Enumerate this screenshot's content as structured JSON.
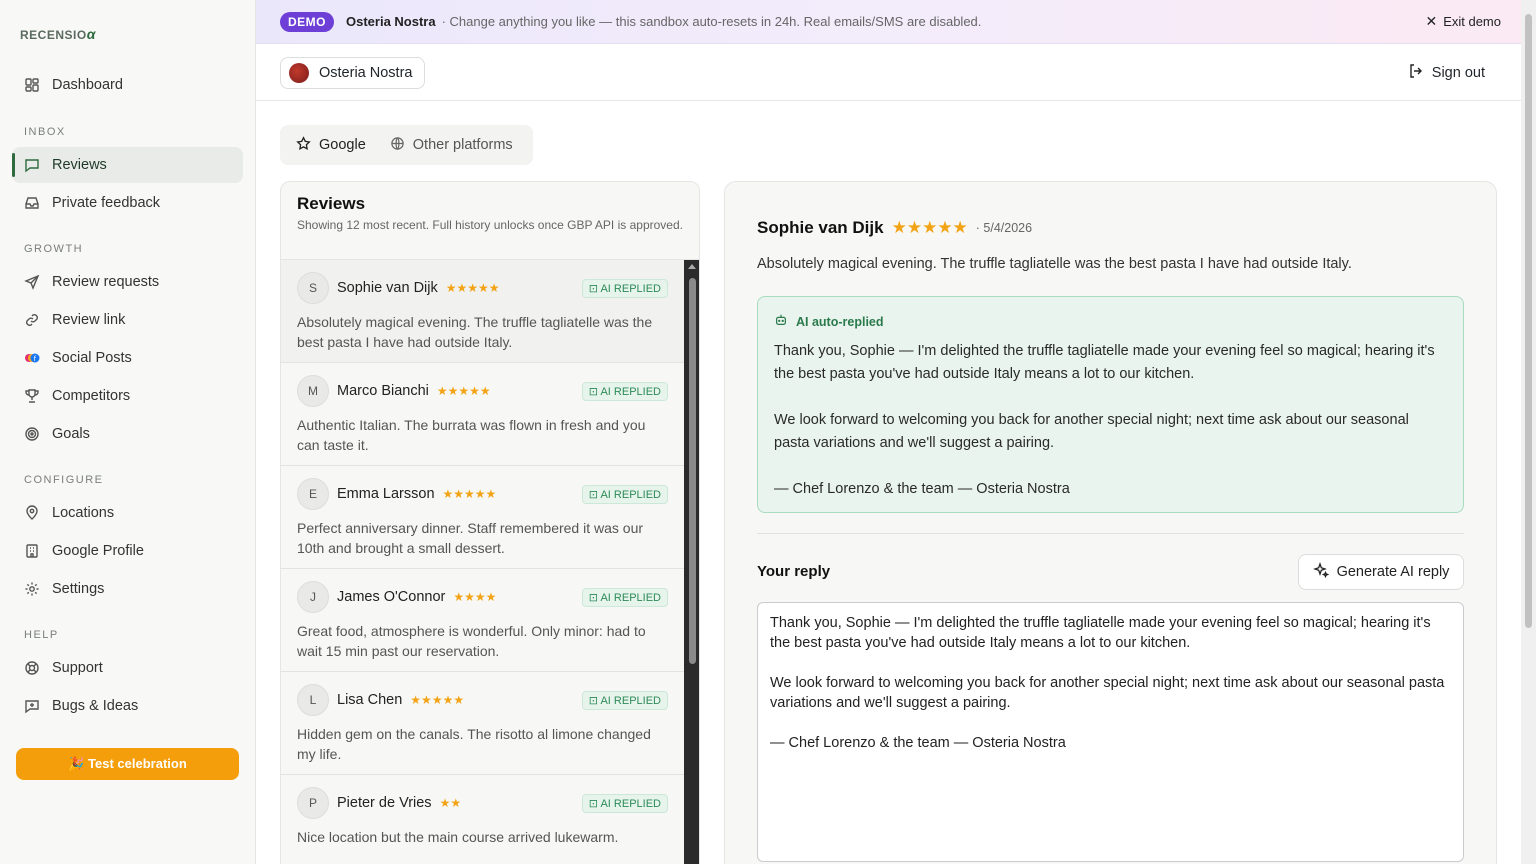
{
  "brand": {
    "logo_text": "RECENSIO",
    "logo_mark": "α"
  },
  "sidebar": {
    "dashboard": "Dashboard",
    "sections": {
      "inbox": "INBOX",
      "growth": "GROWTH",
      "configure": "CONFIGURE",
      "help": "HELP"
    },
    "items": {
      "reviews": "Reviews",
      "private_feedback": "Private feedback",
      "review_requests": "Review requests",
      "review_link": "Review link",
      "social_posts": "Social Posts",
      "competitors": "Competitors",
      "goals": "Goals",
      "locations": "Locations",
      "google_profile": "Google Profile",
      "settings": "Settings",
      "support": "Support",
      "bugs_ideas": "Bugs & Ideas"
    },
    "celebrate_button": "🎉 Test celebration"
  },
  "banner": {
    "pill": "DEMO",
    "business": "Osteria Nostra",
    "message": "· Change anything you like — this sandbox auto-resets in 24h. Real emails/SMS are disabled.",
    "exit": "Exit demo"
  },
  "topbar": {
    "location": "Osteria Nostra",
    "sign_out": "Sign out"
  },
  "tabs": {
    "google": "Google",
    "other": "Other platforms"
  },
  "list": {
    "title": "Reviews",
    "subtitle": "Showing 12 most recent. Full history unlocks once GBP API is approved.",
    "badge": "AI REPLIED",
    "reviews": [
      {
        "initial": "S",
        "name": "Sophie van Dijk",
        "stars": "★★★★★",
        "rating": 5,
        "text": "Absolutely magical evening. The truffle tagliatelle was the best pasta I have had outside Italy."
      },
      {
        "initial": "M",
        "name": "Marco Bianchi",
        "stars": "★★★★★",
        "rating": 5,
        "text": "Authentic Italian. The burrata was flown in fresh and you can taste it."
      },
      {
        "initial": "E",
        "name": "Emma Larsson",
        "stars": "★★★★★",
        "rating": 5,
        "text": "Perfect anniversary dinner. Staff remembered it was our 10th and brought a small dessert."
      },
      {
        "initial": "J",
        "name": "James O'Connor",
        "stars": "★★★★",
        "rating": 4,
        "text": "Great food, atmosphere is wonderful. Only minor: had to wait 15 min past our reservation."
      },
      {
        "initial": "L",
        "name": "Lisa Chen",
        "stars": "★★★★★",
        "rating": 5,
        "text": "Hidden gem on the canals. The risotto al limone changed my life."
      },
      {
        "initial": "P",
        "name": "Pieter de Vries",
        "stars": "★★",
        "rating": 2,
        "text": "Nice location but the main course arrived lukewarm."
      }
    ]
  },
  "detail": {
    "name": "Sophie van Dijk",
    "stars": "★★★★★",
    "date": "· 5/4/2026",
    "text": "Absolutely magical evening. The truffle tagliatelle was the best pasta I have had outside Italy.",
    "ai_label": "AI auto-replied",
    "ai_reply": "Thank you, Sophie — I'm delighted the truffle tagliatelle made your evening feel so magical; hearing it's the best pasta you've had outside Italy means a lot to our kitchen.\n\nWe look forward to welcoming you back for another special night; next time ask about our seasonal pasta variations and we'll suggest a pairing.\n\n— Chef Lorenzo & the team — Osteria Nostra",
    "your_reply": "Your reply",
    "generate": "Generate AI reply",
    "reply_text": "Thank you, Sophie — I'm delighted the truffle tagliatelle made your evening feel so magical; hearing it's the best pasta you've had outside Italy means a lot to our kitchen.\n\nWe look forward to welcoming you back for another special night; next time ask about our seasonal pasta variations and we'll suggest a pairing.\n\n— Chef Lorenzo & the team — Osteria Nostra"
  },
  "colors": {
    "accent_green": "#2f6b3f",
    "demo_purple": "#6d3fd6",
    "star": "#f2a416",
    "celebrate": "#f59e0b"
  }
}
